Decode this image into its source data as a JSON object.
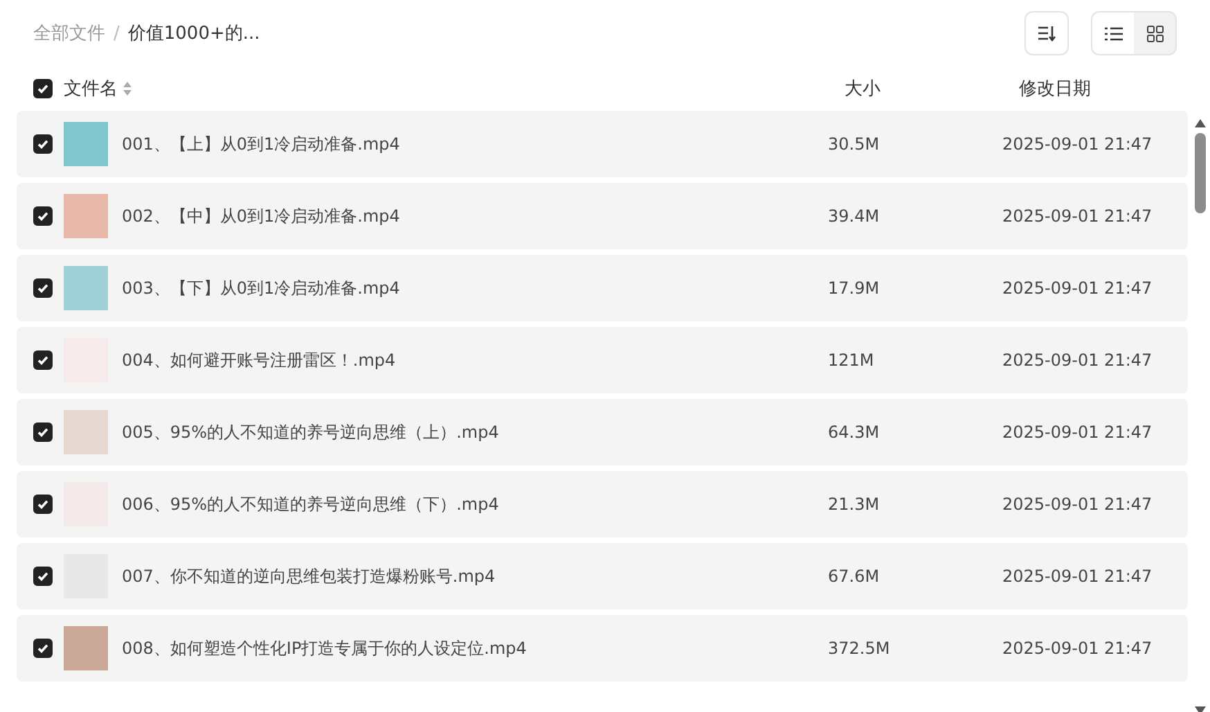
{
  "breadcrumb": {
    "root": "全部文件",
    "separator": "/",
    "current": "价值1000+的..."
  },
  "view_toggle": [
    {
      "kind": "list",
      "selected": true
    },
    {
      "kind": "grid",
      "selected": false
    }
  ],
  "header": {
    "checked": true,
    "columns": [
      "文件名",
      "大小",
      "修改日期"
    ]
  },
  "files": [
    {
      "name": "001、【上】从0到1冷启动准备.mp4",
      "size": "30.5M",
      "modified": "2025-09-01 21:47",
      "checked": true
    },
    {
      "name": "002、【中】从0到1冷启动准备.mp4",
      "size": "39.4M",
      "modified": "2025-09-01 21:47",
      "checked": true
    },
    {
      "name": "003、【下】从0到1冷启动准备.mp4",
      "size": "17.9M",
      "modified": "2025-09-01 21:47",
      "checked": true
    },
    {
      "name": "004、如何避开账号注册雷区！.mp4",
      "size": "121M",
      "modified": "2025-09-01 21:47",
      "checked": true
    },
    {
      "name": "005、95%的人不知道的养号逆向思维（上）.mp4",
      "size": "64.3M",
      "modified": "2025-09-01 21:47",
      "checked": true
    },
    {
      "name": "006、95%的人不知道的养号逆向思维（下）.mp4",
      "size": "21.3M",
      "modified": "2025-09-01 21:47",
      "checked": true
    },
    {
      "name": "007、你不知道的逆向思维包装打造爆粉账号.mp4",
      "size": "67.6M",
      "modified": "2025-09-01 21:47",
      "checked": true
    },
    {
      "name": "008、如何塑造个性化IP打造专属于你的人设定位.mp4",
      "size": "372.5M",
      "modified": "2025-09-01 21:47",
      "checked": true
    }
  ]
}
